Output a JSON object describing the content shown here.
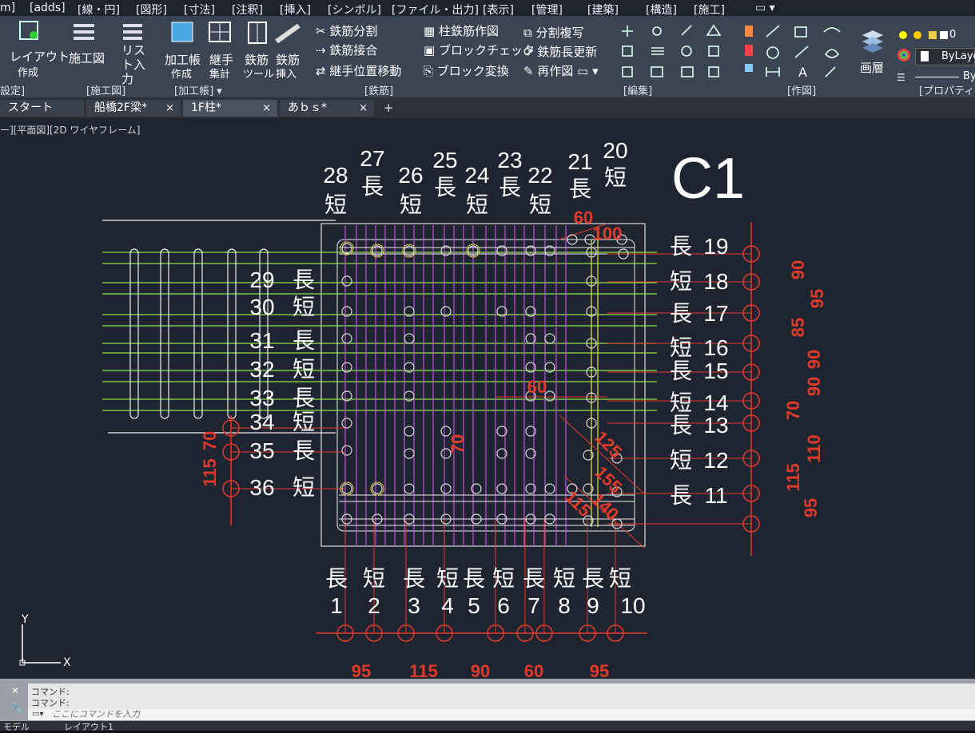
{
  "menubar": [
    "m]",
    "[adds]",
    "[線・円]",
    "[図形]",
    "[寸法]",
    "[注釈]",
    "[挿入]",
    "[シンボル]",
    "[ファイル・出力]",
    "[表示]",
    "[管理]",
    "[建築]",
    "[構造]",
    "[施工]"
  ],
  "ribbon": {
    "buttons": {
      "layout": "レイアウト",
      "layout_sub": "作成",
      "construction_drawing": "施工図",
      "list_input": "リスト入力",
      "process_book": "加工帳",
      "process_sub": "作成",
      "joint": "継手",
      "joint_sub": "集計",
      "rebar_tool": "鉄筋",
      "rebar_tool_sub": "ツール",
      "rebar_insert": "鉄筋",
      "rebar_insert_sub": "挿入",
      "rebar_split": "鉄筋分割",
      "rebar_join": "鉄筋接合",
      "joint_move": "継手位置移動",
      "column_draw": "柱鉄筋作図",
      "block_check": "ブロックチェック",
      "block_convert": "ブロック変換",
      "split_copy": "分割複写",
      "length_update": "鉄筋長更新",
      "redraw": "再作図",
      "layer": "画層",
      "bylayer": "ByLayer",
      "bylayer2": "By",
      "layer_num": "0"
    },
    "groups": {
      "settings": "設定]",
      "construction": "[施工図]",
      "process": "[加工帳] ▾",
      "rebar": "[鉄筋]",
      "edit": "[編集]",
      "draw": "[作図]",
      "props": "[プロパティ"
    }
  },
  "tabs": [
    {
      "label": "スタート",
      "close": ""
    },
    {
      "label": "船橋2F梁*",
      "close": "×"
    },
    {
      "label": "1F柱*",
      "close": "×"
    },
    {
      "label": "あｂｓ*",
      "close": "×"
    }
  ],
  "tab_add": "+",
  "viewport_label": "ー][平面図][2D ワイヤフレーム]",
  "drawing": {
    "title": "C1",
    "top_nums": [
      "28",
      "27",
      "26",
      "25",
      "24",
      "23",
      "22",
      "21",
      "20"
    ],
    "top_kinds": [
      "短",
      "長",
      "短",
      "長",
      "短",
      "長",
      "短",
      "長",
      "短"
    ],
    "right_nums": [
      "19",
      "18",
      "17",
      "16",
      "15",
      "14",
      "13",
      "12",
      "11"
    ],
    "right_kinds": [
      "長",
      "短",
      "長",
      "短",
      "長",
      "短",
      "長",
      "短",
      "長"
    ],
    "left_nums": [
      "29",
      "30",
      "31",
      "32",
      "33",
      "34",
      "35",
      "36"
    ],
    "left_kinds": [
      "長",
      "短",
      "長",
      "短",
      "長",
      "短",
      "長",
      "短"
    ],
    "bottom_nums": [
      "1",
      "2",
      "3",
      "4",
      "5",
      "6",
      "7",
      "8",
      "9",
      "10"
    ],
    "bottom_kinds": [
      "長",
      "短",
      "長",
      "短",
      "長",
      "短",
      "長",
      "短",
      "長",
      "短"
    ],
    "bottom_dims": [
      "95",
      "115",
      "90",
      "60",
      "95"
    ],
    "right_dims_a": [
      "90",
      "95",
      "85",
      "90",
      "70",
      "90",
      "110",
      "115",
      "95"
    ],
    "left_dims": [
      "115",
      "70"
    ],
    "inner_dims": [
      "60",
      "100",
      "60",
      "70",
      "125",
      "155",
      "140",
      "115"
    ]
  },
  "ucs": {
    "y": "Y",
    "x": "X"
  },
  "command": {
    "line1": "コマンド:",
    "line2": "コマンド:",
    "placeholder": "ここにコマンドを入力"
  },
  "status": {
    "model": "モデル",
    "layout": "レイアウト1"
  }
}
